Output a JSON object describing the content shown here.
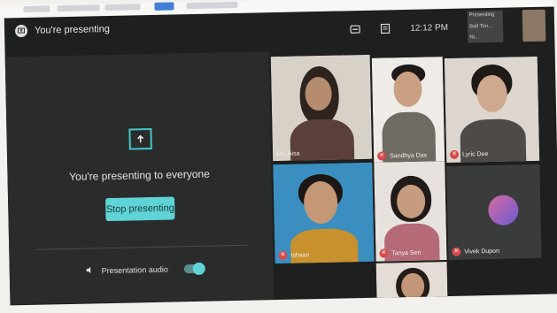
{
  "header": {
    "title": "You're presenting",
    "time": "12:12 PM",
    "self_view_lines": [
      "Presenting",
      "Ball Tim...",
      "Ni..."
    ]
  },
  "presenting_panel": {
    "message": "You're presenting to everyone",
    "stop_button_label": "Stop presenting",
    "audio_label": "Presentation audio",
    "audio_enabled": true
  },
  "participants": [
    {
      "name": "Ms. Aisa",
      "muted": false
    },
    {
      "name": "Sandhya Das",
      "muted": true
    },
    {
      "name": "Lyric Dee",
      "muted": true
    },
    {
      "name": "Ishaan",
      "muted": true
    },
    {
      "name": "Tanya Sen",
      "muted": true
    },
    {
      "name": "Vivek Dupon",
      "muted": true
    },
    {
      "name": "",
      "muted": false
    }
  ],
  "colors": {
    "accent": "#5fd3d5",
    "background": "#1e1f1f",
    "muted_badge": "#d84a4a"
  },
  "icons": [
    "present-screen-icon",
    "captions-icon",
    "chat-icon",
    "upload-arrow-icon",
    "speaker-icon",
    "mic-off-icon"
  ]
}
